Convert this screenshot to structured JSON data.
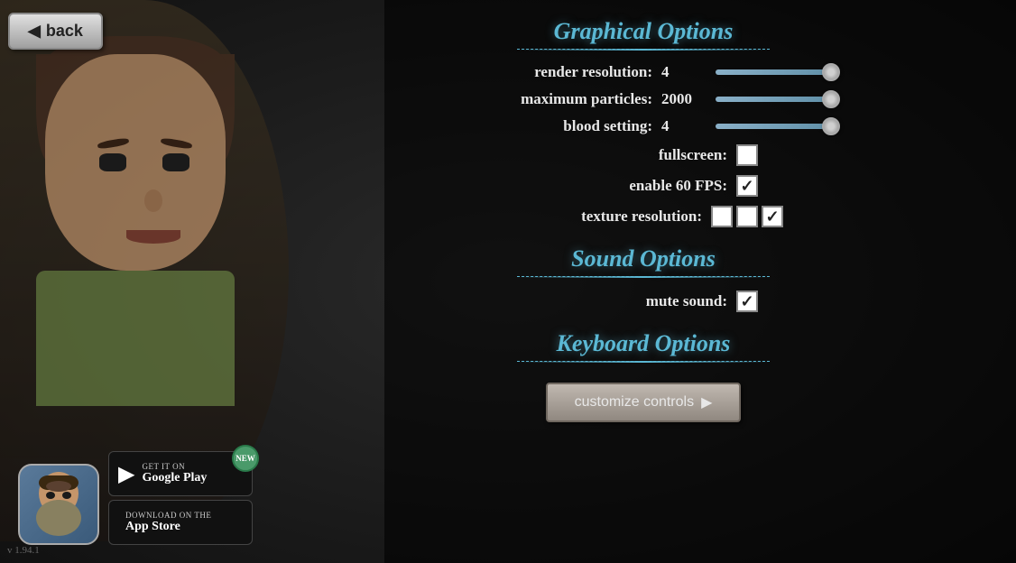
{
  "app": {
    "version": "v 1.94.1"
  },
  "back_button": {
    "label": "back"
  },
  "graphical_options": {
    "title": "Graphical Options",
    "settings": [
      {
        "label": "render resolution:",
        "value": "4",
        "type": "slider",
        "slider_percent": 85
      },
      {
        "label": "maximum particles:",
        "value": "2000",
        "type": "slider",
        "slider_percent": 85
      },
      {
        "label": "blood setting:",
        "value": "4",
        "type": "slider",
        "slider_percent": 85
      },
      {
        "label": "fullscreen:",
        "type": "checkbox",
        "checked": false
      },
      {
        "label": "enable 60 FPS:",
        "type": "checkbox",
        "checked": true
      },
      {
        "label": "texture resolution:",
        "type": "triple_checkbox",
        "values": [
          false,
          false,
          true
        ]
      }
    ]
  },
  "sound_options": {
    "title": "Sound Options",
    "settings": [
      {
        "label": "mute sound:",
        "type": "checkbox",
        "checked": true
      }
    ]
  },
  "keyboard_options": {
    "title": "Keyboard Options",
    "customize_button": "customize controls"
  },
  "google_play": {
    "line1": "GET IT ON",
    "line2": "Google Play"
  },
  "app_store": {
    "line1": "Download on the",
    "line2": "App Store"
  },
  "new_badge": "NEW"
}
